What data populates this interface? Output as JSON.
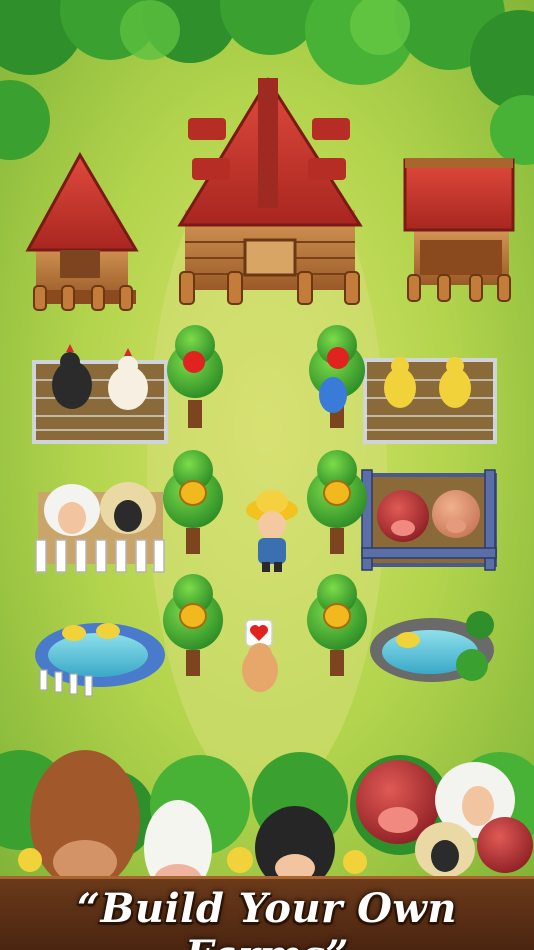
{
  "game": {
    "banner_text": "“Build Your Own Farms”"
  },
  "farm": {
    "buildings": [
      "farmhouse",
      "small-barn",
      "market-stall"
    ],
    "pens": [
      "chicken-coop",
      "sheep-pen",
      "pig-pen",
      "duck-pond-left",
      "duck-pond-right"
    ],
    "trees": [
      "apple-tree",
      "apple-tree",
      "honey-tree",
      "honey-tree",
      "honey-tree",
      "honey-tree"
    ],
    "characters": [
      "farmer-boy",
      "dog-with-heart"
    ]
  },
  "icons": {
    "fruit": "apple-icon",
    "honey": "honey-pot-icon",
    "heart": "heart-icon"
  },
  "colors": {
    "grass": "#a9cf45",
    "path": "#c9d86a",
    "roof_red": "#c9302c",
    "wood": "#a8652d",
    "banner_wood": "#5a2e12",
    "tree_green": "#3fa82e"
  }
}
